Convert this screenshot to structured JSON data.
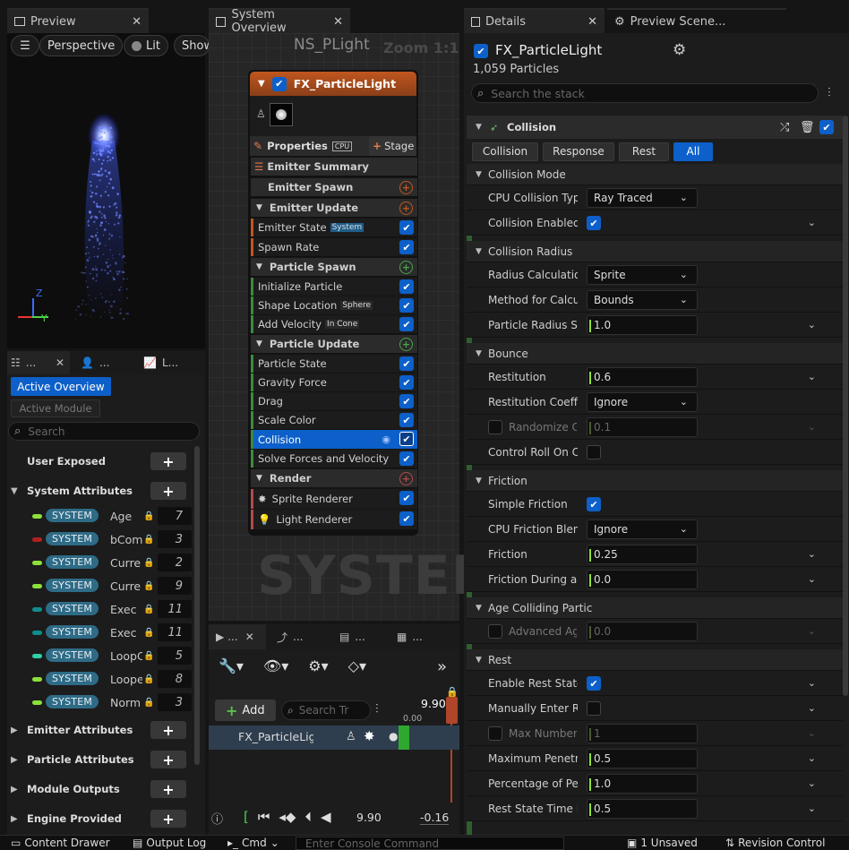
{
  "preview_panel": {
    "tab_label": "Preview",
    "toolbar": {
      "perspective": "Perspective",
      "lit": "Lit",
      "show": "Show"
    },
    "axis": {
      "z": "Z",
      "y": "Y"
    }
  },
  "left_tabs": {
    "tab1": "...",
    "tab2": "...",
    "tab3": "L..."
  },
  "params": {
    "active_overview": "Active Overview",
    "active_module": "Active Module",
    "search_placeholder": "Search",
    "sections": {
      "user_exposed": "User Exposed",
      "system_attributes": "System Attributes",
      "emitter_attributes": "Emitter Attributes",
      "particle_attributes": "Particle Attributes",
      "module_outputs": "Module Outputs",
      "engine_provided": "Engine Provided"
    },
    "attributes": [
      {
        "badge": "SYSTEM",
        "name": "Age",
        "value": "7",
        "color": "#8de03a"
      },
      {
        "badge": "SYSTEM",
        "name": "bCom",
        "value": "3",
        "color": "#b22020"
      },
      {
        "badge": "SYSTEM",
        "name": "Curre",
        "value": "2",
        "color": "#8de03a"
      },
      {
        "badge": "SYSTEM",
        "name": "Curre",
        "value": "9",
        "color": "#8de03a"
      },
      {
        "badge": "SYSTEM",
        "name": "Exec",
        "value": "11",
        "color": "#0f8c8c"
      },
      {
        "badge": "SYSTEM",
        "name": "Exec",
        "value": "11",
        "color": "#0f8c8c"
      },
      {
        "badge": "SYSTEM",
        "name": "LoopC",
        "value": "5",
        "color": "#2ed0a8"
      },
      {
        "badge": "SYSTEM",
        "name": "Loope",
        "value": "8",
        "color": "#8de03a"
      },
      {
        "badge": "SYSTEM",
        "name": "Norm",
        "value": "3",
        "color": "#8de03a"
      }
    ]
  },
  "system_overview": {
    "tab_label": "System Overview",
    "graph_title": "NS_PLight",
    "zoom": "Zoom 1:1",
    "watermark": "SYSTEM",
    "emitter": {
      "name": "FX_ParticleLight",
      "properties": "Properties",
      "cpu": "CPU",
      "stage": "Stage",
      "groups": {
        "emitter_summary": "Emitter Summary",
        "emitter_spawn": "Emitter Spawn",
        "emitter_update": "Emitter Update",
        "particle_spawn": "Particle Spawn",
        "particle_update": "Particle Update",
        "render": "Render"
      },
      "modules": {
        "emitter_state": "Emitter State",
        "emitter_state_tag": "System",
        "spawn_rate": "Spawn Rate",
        "initialize_particle": "Initialize Particle",
        "shape_location": "Shape Location",
        "shape_location_tag": "Sphere",
        "add_velocity": "Add Velocity",
        "add_velocity_tag": "In Cone",
        "particle_state": "Particle State",
        "gravity_force": "Gravity Force",
        "drag": "Drag",
        "scale_color": "Scale Color",
        "collision": "Collision",
        "solve_forces": "Solve Forces and Velocity",
        "sprite_renderer": "Sprite Renderer",
        "light_renderer": "Light Renderer"
      }
    }
  },
  "timeline": {
    "tab1": "...",
    "tab2": "...",
    "tab3": "...",
    "tab4": "...",
    "add": "Add",
    "search_placeholder": "Search Tr",
    "time_value": "9.90",
    "time_start": "0.00",
    "track_name": "FX_ParticleLigl",
    "current_time": "9.90",
    "end_time": "-0.16"
  },
  "details": {
    "tab_label": "Details",
    "tab2_label": "Preview Scene...",
    "emitter_name": "FX_ParticleLight",
    "particles_count": "1,059 Particles",
    "search_placeholder": "Search the stack",
    "collision_header": "Collision",
    "filter_tabs": [
      "Collision",
      "Response",
      "Rest",
      "All"
    ],
    "sections": {
      "collision_mode": "Collision Mode",
      "collision_radius": "Collision Radius",
      "bounce": "Bounce",
      "friction": "Friction",
      "age_colliding": "Age Colliding Partic",
      "rest": "Rest"
    },
    "rows": {
      "cpu_collision_type": {
        "label": "CPU Collision Type",
        "value": "Ray Traced"
      },
      "collision_enabled": {
        "label": "Collision Enabled"
      },
      "radius_calculation": {
        "label": "Radius Calculation T",
        "value": "Sprite"
      },
      "method_for_calc": {
        "label": "Method for Calculat",
        "value": "Bounds"
      },
      "particle_radius_scale": {
        "label": "Particle Radius Sca",
        "value": "1.0"
      },
      "restitution": {
        "label": "Restitution",
        "value": "0.6"
      },
      "restitution_coeff": {
        "label": "Restitution Coeffici",
        "value": "Ignore"
      },
      "randomize_col": {
        "label": "Randomize Col",
        "value": "0.1"
      },
      "control_roll": {
        "label": "Control Roll On Coll"
      },
      "simple_friction": {
        "label": "Simple Friction"
      },
      "cpu_friction_blend": {
        "label": "CPU Friction Blendi",
        "value": "Ignore"
      },
      "friction": {
        "label": "Friction",
        "value": "0.25"
      },
      "friction_during": {
        "label": "Friction During a Bo",
        "value": "0.0"
      },
      "advanced_aging": {
        "label": "Advanced Agin",
        "value": "0.0"
      },
      "enable_rest_state": {
        "label": "Enable Rest State"
      },
      "manually_enter_rest": {
        "label": "Manually Enter Res"
      },
      "max_number": {
        "label": "Max Number C",
        "value": "1"
      },
      "max_penetration": {
        "label": "Maximum Penetrat",
        "value": "0.5"
      },
      "percentage_pene": {
        "label": "Percentage of Pene",
        "value": "1.0"
      },
      "rest_state_time": {
        "label": "Rest State Time Ra",
        "value": "0.5"
      }
    }
  },
  "bottom_bar": {
    "content_drawer": "Content Drawer",
    "output_log": "Output Log",
    "cmd": "Cmd",
    "console_placeholder": "Enter Console Command",
    "unsaved": "1 Unsaved",
    "revision_control": "Revision Control"
  }
}
